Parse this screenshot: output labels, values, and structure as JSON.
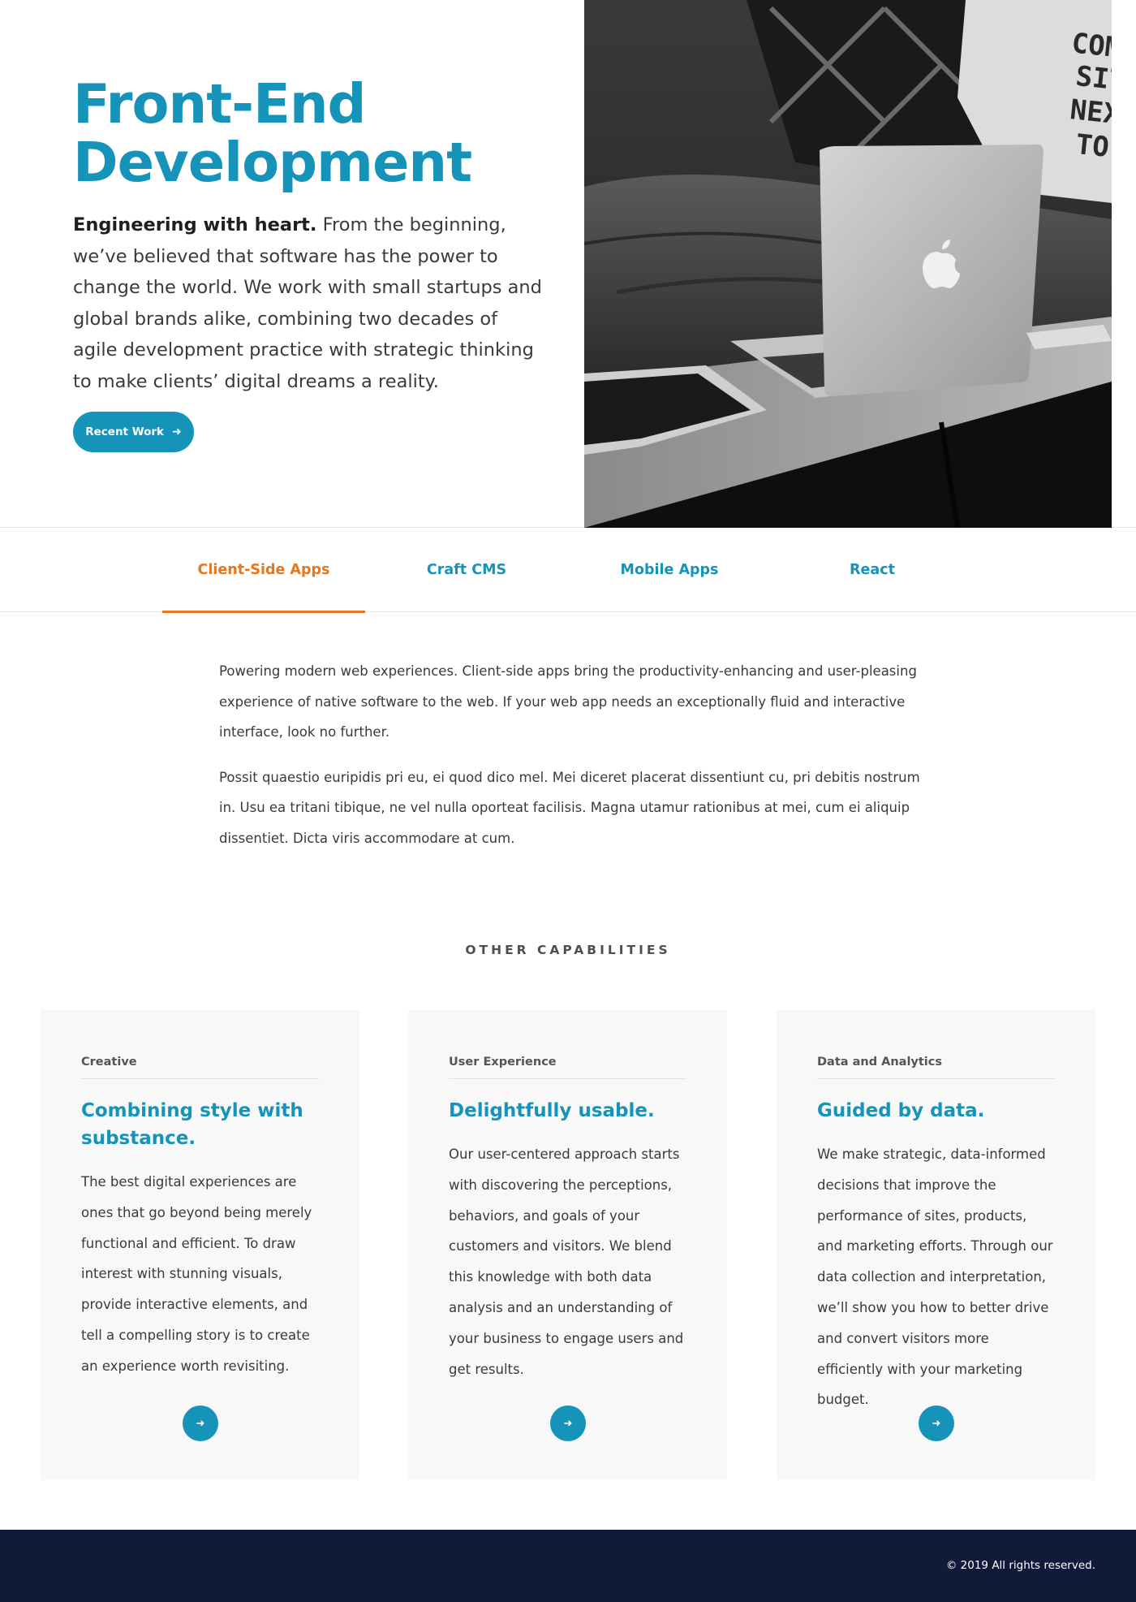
{
  "hero": {
    "title_line1": "Front-End",
    "title_line2": "Development",
    "lead_strong": "Engineering with heart.",
    "lead_body": " From the beginning, we’ve believed that software has the power to change the world. We work with small startups and global brands alike, combining two decades of agile development practice with strategic thinking to make clients’ digital dreams a reality.",
    "button_label": "Recent Work",
    "button_icon": "arrow-right-icon",
    "image_subject": "laptop-on-table-photo",
    "pillow_text": "COME SIT NEXT TO ME"
  },
  "tabs": [
    {
      "label": "Client-Side Apps",
      "active": true
    },
    {
      "label": "Craft CMS",
      "active": false
    },
    {
      "label": "Mobile Apps",
      "active": false
    },
    {
      "label": "React",
      "active": false
    }
  ],
  "content": {
    "paragraph1": "Powering modern web experiences. Client-side apps bring the productivity-enhancing and user-pleasing experience of native software to the web. If your web app needs an exceptionally fluid and interactive interface, look no further.",
    "paragraph2": "Possit quaestio euripidis pri eu, ei quod dico mel. Mei diceret placerat dissentiunt cu, pri debitis nostrum in. Usu ea tritani tibique, ne vel nulla oporteat facilisis. Magna utamur rationibus at mei, cum ei aliquip dissentiet. Dicta viris accommodare at cum."
  },
  "capabilities": {
    "heading": "OTHER CAPABILITIES",
    "cards": [
      {
        "category": "Creative",
        "title": "Combining style with substance.",
        "body": "The best digital experiences are ones that go beyond being merely functional and efficient. To draw interest with stunning visuals, provide interactive elements, and tell a compelling story is to create an experience worth revisiting."
      },
      {
        "category": "User Experience",
        "title": "Delightfully usable.",
        "body": "Our user-centered approach starts with discovering the perceptions, behaviors, and goals of your customers and visitors. We blend this knowledge with both data analysis and an understanding of your business to engage users and get results."
      },
      {
        "category": "Data and Analytics",
        "title": "Guided by data.",
        "body": "We make strategic, data-informed decisions that improve the performance of sites, products, and marketing efforts. Through our data collection and interpretation, we’ll show you how to better drive and convert visitors more efficiently with your marketing budget."
      }
    ]
  },
  "footer": {
    "copyright": "© 2019 All rights reserved."
  },
  "colors": {
    "accent": "#1693b9",
    "active_tab": "#e4761e",
    "footer_bg": "#121a3a",
    "card_bg": "#f8f8f8"
  }
}
